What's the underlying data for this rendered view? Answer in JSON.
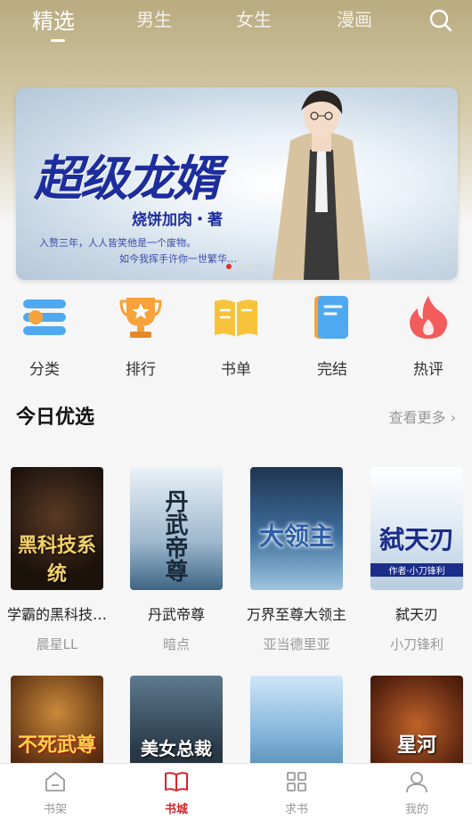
{
  "top_nav": {
    "tabs": [
      {
        "label": "精选",
        "active": true
      },
      {
        "label": "男生",
        "active": false
      },
      {
        "label": "女生",
        "active": false
      },
      {
        "label": "漫画",
        "active": false
      }
    ],
    "search_icon": "search-icon"
  },
  "banner": {
    "title": "超级龙婿",
    "author": "烧饼加肉・著",
    "line1": "入赘三年，人人皆笑他是一个废物。",
    "line2": "如今我挥手许你一世繁华…",
    "page_count": 4,
    "active_index": 0
  },
  "categories": [
    {
      "label": "分类",
      "icon": "category-icon"
    },
    {
      "label": "排行",
      "icon": "trophy-icon"
    },
    {
      "label": "书单",
      "icon": "book-list-icon"
    },
    {
      "label": "完结",
      "icon": "finished-book-icon"
    },
    {
      "label": "热评",
      "icon": "flame-icon"
    }
  ],
  "today_picks": {
    "title": "今日优选",
    "more": "查看更多",
    "books": [
      {
        "title": "学霸的黑科技…",
        "author": "晨星LL",
        "cover_text": "黑科技系统"
      },
      {
        "title": "丹武帝尊",
        "author": "暗点",
        "cover_text": "丹武帝尊"
      },
      {
        "title": "万界至尊大领主",
        "author": "亚当德里亚",
        "cover_text": "大领主"
      },
      {
        "title": "弑天刃",
        "author": "小刀锋利",
        "cover_text": "弑天刃",
        "cover_subtext": "作者·小刀锋利"
      }
    ],
    "row2_covers": [
      {
        "cover_text": "不死武尊"
      },
      {
        "cover_text": "美女总裁"
      },
      {
        "cover_text": ""
      },
      {
        "cover_text": "星河"
      }
    ]
  },
  "bottom_nav": [
    {
      "label": "书架",
      "icon": "bookshelf-icon",
      "active": false
    },
    {
      "label": "书城",
      "icon": "bookstore-icon",
      "active": true
    },
    {
      "label": "求书",
      "icon": "request-grid-icon",
      "active": false
    },
    {
      "label": "我的",
      "icon": "profile-icon",
      "active": false
    }
  ],
  "colors": {
    "accent": "#d6252b",
    "header_gold": "#b9ab7f",
    "banner_title": "#1d2d9c"
  }
}
